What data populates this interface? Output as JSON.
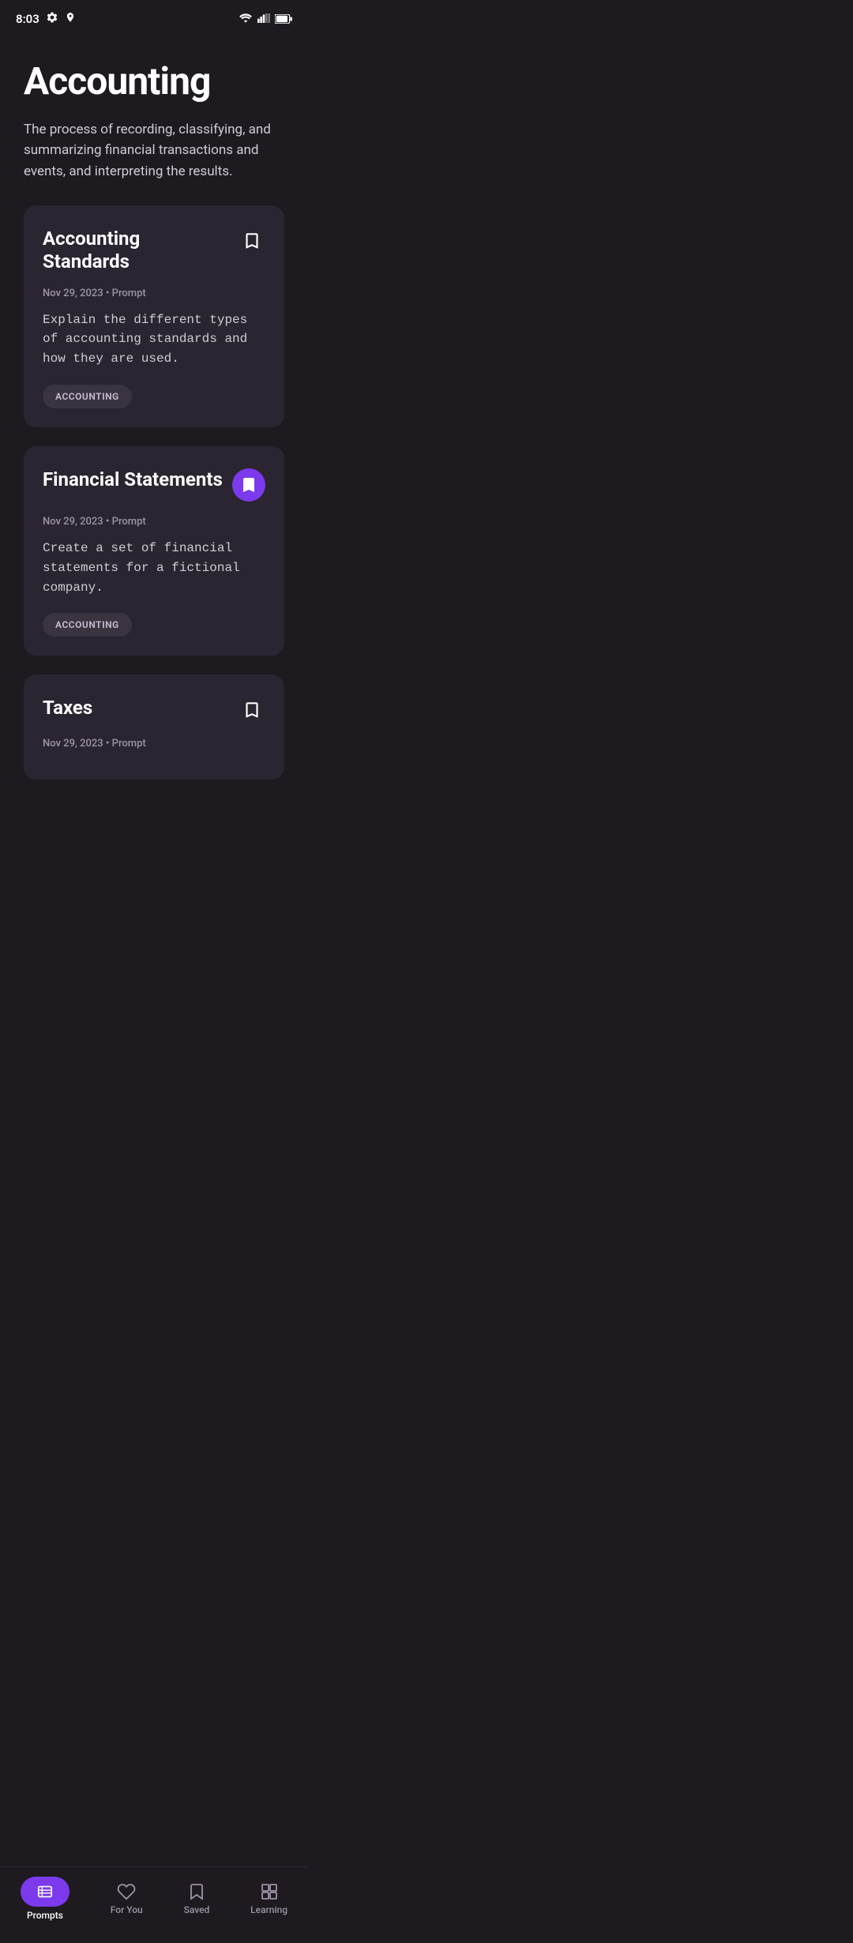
{
  "statusBar": {
    "time": "8:03",
    "icons": [
      "settings",
      "location",
      "wifi",
      "signal",
      "battery"
    ]
  },
  "page": {
    "title": "Accounting",
    "description": "The process of recording, classifying, and summarizing financial transactions and events, and interpreting the results."
  },
  "cards": [
    {
      "id": "card-1",
      "title": "Accounting Standards",
      "meta": "Nov 29, 2023 • Prompt",
      "body": "Explain the different types of accounting standards and how they are used.",
      "tag": "ACCOUNTING",
      "bookmarked": false
    },
    {
      "id": "card-2",
      "title": "Financial Statements",
      "meta": "Nov 29, 2023 • Prompt",
      "body": "Create a set of financial statements for a fictional company.",
      "tag": "ACCOUNTING",
      "bookmarked": true
    },
    {
      "id": "card-3",
      "title": "Taxes",
      "meta": "Nov 29, 2023 • Prompt",
      "body": "",
      "tag": "",
      "bookmarked": false,
      "partial": true
    }
  ],
  "bottomNav": {
    "items": [
      {
        "id": "prompts",
        "label": "Prompts",
        "active": true
      },
      {
        "id": "for-you",
        "label": "For You",
        "active": false
      },
      {
        "id": "saved",
        "label": "Saved",
        "active": false
      },
      {
        "id": "learning",
        "label": "Learning",
        "active": false
      }
    ]
  }
}
